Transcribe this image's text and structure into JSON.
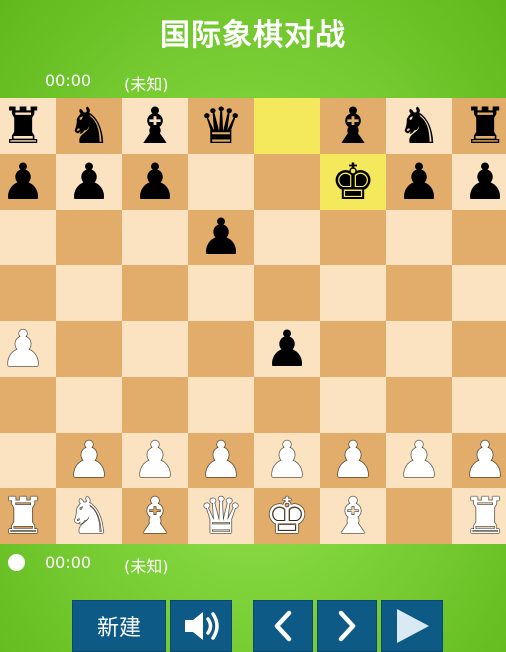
{
  "title": "国际象棋对战",
  "top_player": {
    "time": "00:00",
    "name": "(未知)"
  },
  "bottom_player": {
    "time": "00:00",
    "name": "(未知)"
  },
  "board": {
    "highlight": [
      [
        0,
        4
      ],
      [
        1,
        5
      ]
    ],
    "rows": [
      [
        "bR",
        "bN",
        "bB",
        "bQ",
        "",
        "bB",
        "bN",
        "bR"
      ],
      [
        "bP",
        "bP",
        "bP",
        "",
        "",
        "bK",
        "bP",
        "bP"
      ],
      [
        "",
        "",
        "",
        "bP",
        "",
        "",
        "",
        ""
      ],
      [
        "",
        "",
        "",
        "",
        "",
        "",
        "",
        ""
      ],
      [
        "wP",
        "",
        "",
        "",
        "bP",
        "",
        "",
        ""
      ],
      [
        "",
        "",
        "",
        "",
        "",
        "",
        "",
        ""
      ],
      [
        "",
        "wP",
        "wP",
        "wP",
        "wP",
        "wP",
        "wP",
        "wP"
      ],
      [
        "wR",
        "wN",
        "wB",
        "wQ",
        "wK",
        "wB",
        "",
        "wR"
      ]
    ],
    "colors": {
      "light": "#fbe3c2",
      "dark": "#e2ad6a",
      "highlight": "#f4e95c"
    }
  },
  "controls": {
    "new_label": "新建",
    "sound_icon": "speaker-icon",
    "prev_icon": "chevron-left-icon",
    "next_icon": "chevron-right-icon",
    "play_icon": "play-icon"
  }
}
